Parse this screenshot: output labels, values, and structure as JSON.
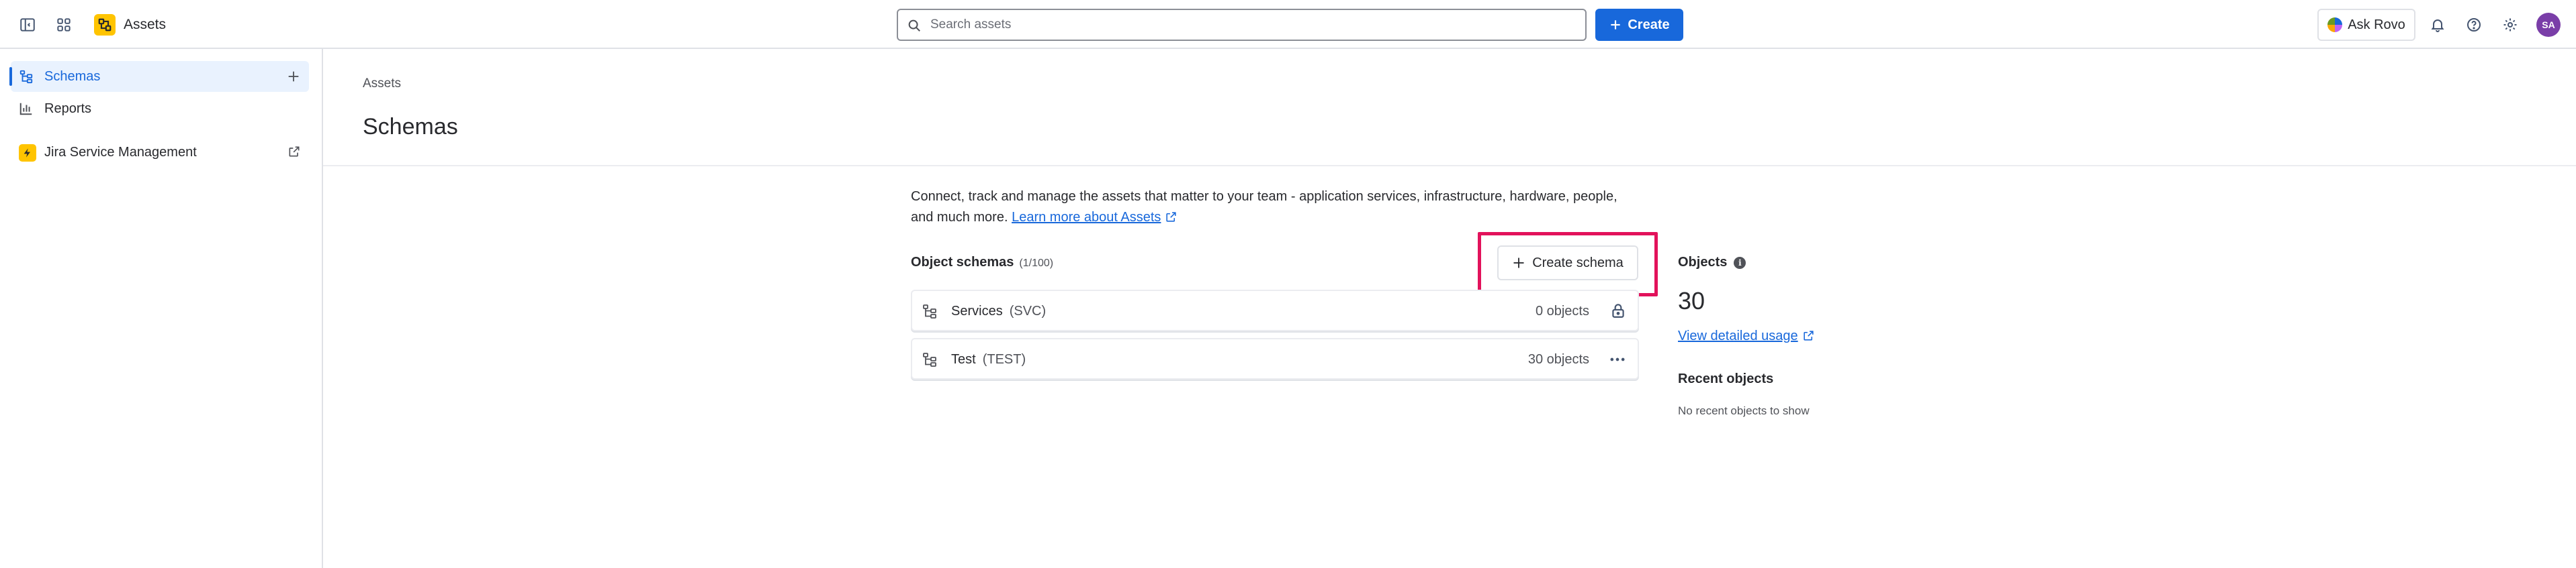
{
  "app": {
    "title": "Assets"
  },
  "search": {
    "placeholder": "Search assets"
  },
  "header": {
    "create_label": "Create",
    "ask_rovo_label": "Ask Rovo",
    "avatar_initials": "SA"
  },
  "sidebar": {
    "items": [
      {
        "label": "Schemas",
        "icon": "schema-icon",
        "active": true
      },
      {
        "label": "Reports",
        "icon": "chart-icon",
        "active": false
      },
      {
        "label": "Jira Service Management",
        "icon": "jsm-logo",
        "active": false
      }
    ]
  },
  "main": {
    "breadcrumb": "Assets",
    "title": "Schemas",
    "description": "Connect, track and manage the assets that matter to your team - application services, infrastructure, hardware, people, and much more.",
    "learn_more": "Learn more about Assets",
    "object_schemas_label": "Object schemas",
    "object_schemas_count": "(1/100)",
    "create_schema_label": "Create schema",
    "schemas": [
      {
        "name": "Services",
        "key": "(SVC)",
        "count": "0 objects",
        "action_icon": "lock-icon"
      },
      {
        "name": "Test",
        "key": "(TEST)",
        "count": "30 objects",
        "action_icon": "more-icon"
      }
    ]
  },
  "objects_panel": {
    "title": "Objects",
    "count": "30",
    "usage_link": "View detailed usage",
    "recent_title": "Recent objects",
    "recent_empty": "No recent objects to show"
  },
  "colors": {
    "brand_blue": "#1868db",
    "highlight": "#e2125b",
    "assets_yellow": "#ffc400"
  }
}
